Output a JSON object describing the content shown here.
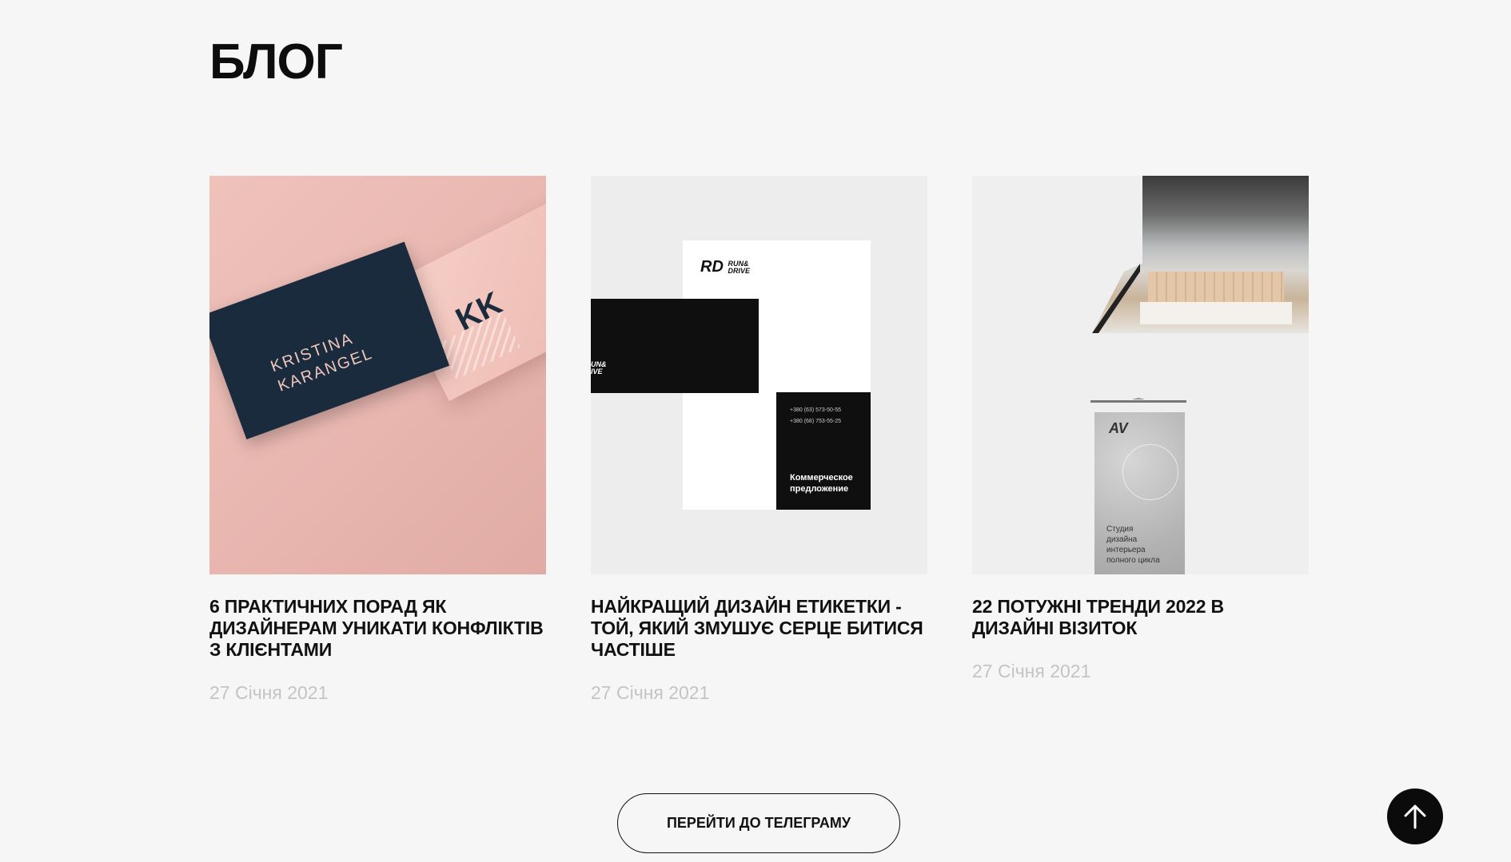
{
  "page": {
    "title": "БЛОГ"
  },
  "posts": [
    {
      "title": "6 практичних порад як дизайнерам уникати конфліктів з клієнтами",
      "date": "27 Січня 2021",
      "image": {
        "brand_name": "KRISTINA KARANGEL",
        "monogram": "KK"
      }
    },
    {
      "title": "Найкращий дизайн етикетки - той, який змушує серце битися частіше",
      "date": "27 Січня 2021",
      "image": {
        "logo_text": "RD",
        "logo_sub": "RUN& DRIVE",
        "card_fragment": "UN& IVE",
        "phones": [
          "+380 (63) 573-50-55",
          "+380 (68) 753-55-25"
        ],
        "offer": "Коммерческое предложение"
      }
    },
    {
      "title": "22 потужні тренди 2022 в дизайні візиток",
      "date": "27 Січня 2021",
      "image": {
        "banner_logo": "AV",
        "banner_text": "Студия дизайна интерьера полного цикла"
      }
    }
  ],
  "cta": {
    "label": "ПЕРЕЙТИ ДО ТЕЛЕГРАМУ"
  },
  "icons": {
    "scroll_top": "arrow-up-icon"
  }
}
